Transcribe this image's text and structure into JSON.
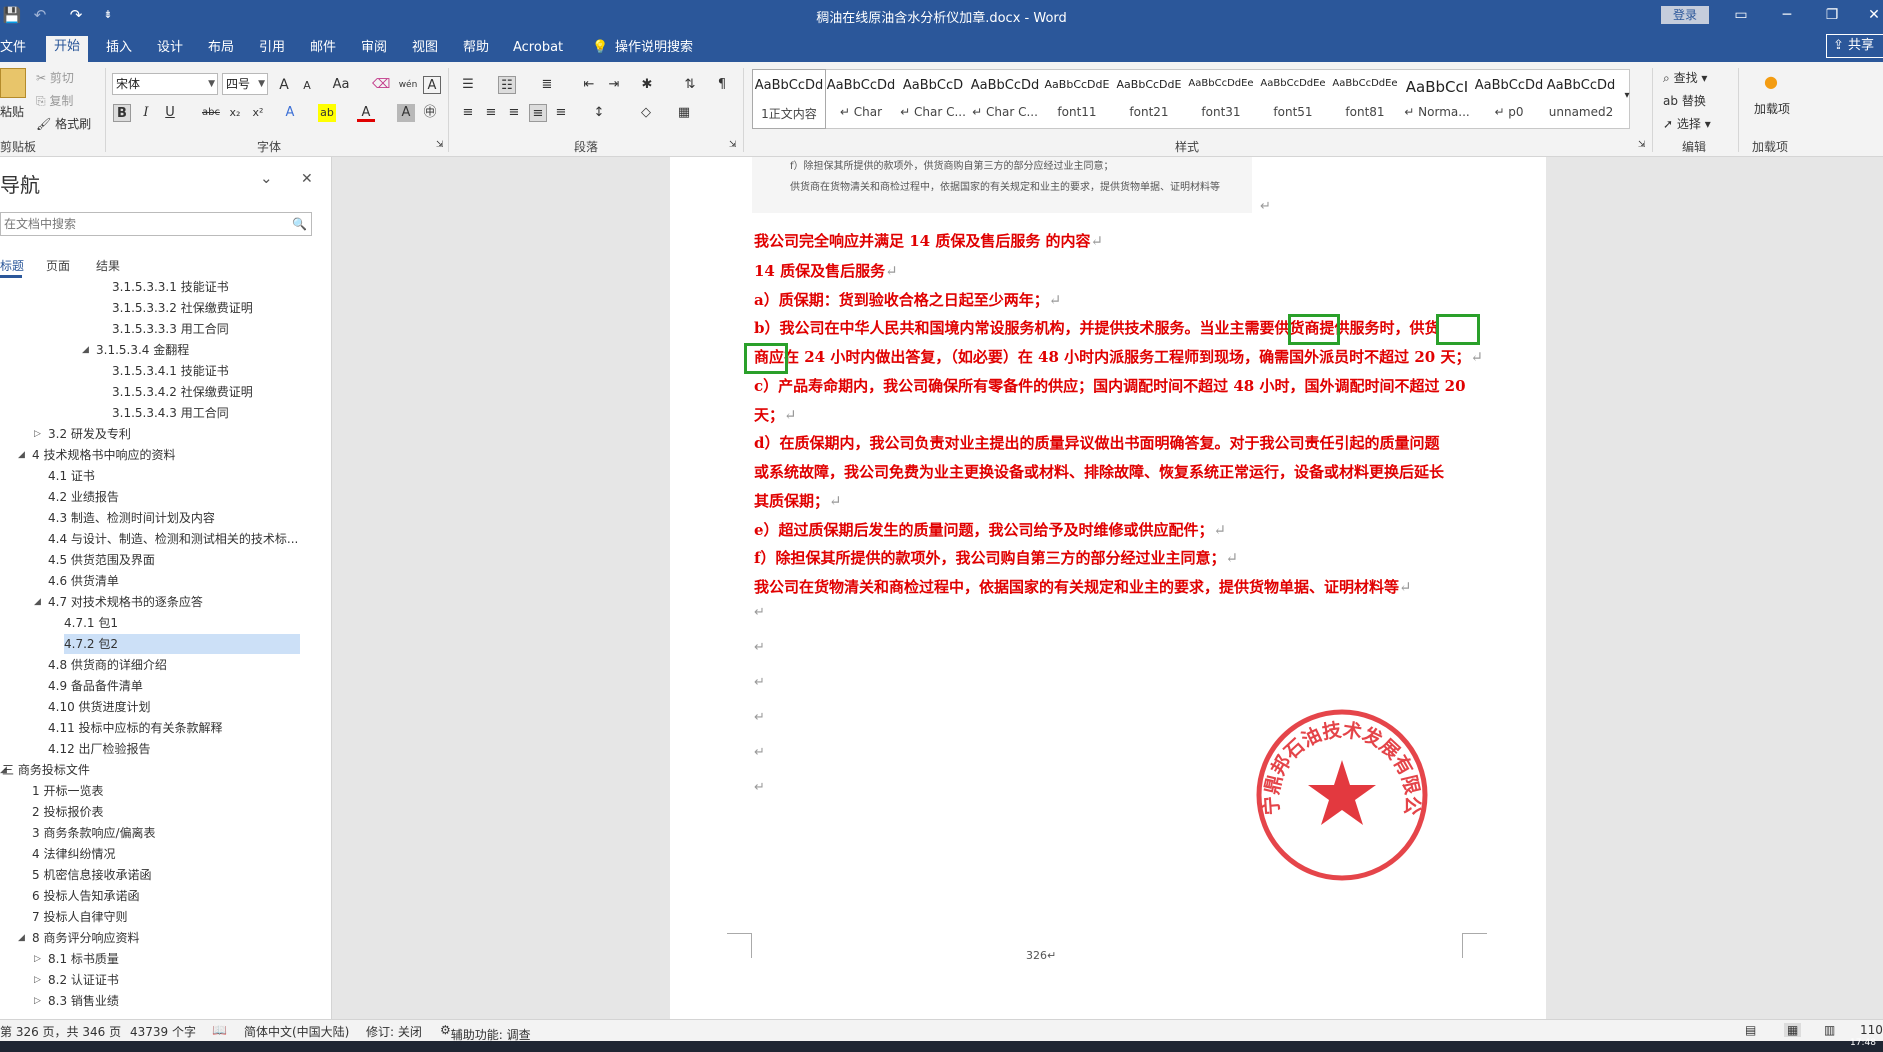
{
  "titlebar": {
    "title": "稠油在线原油含水分析仪加章.docx  -  Word",
    "login": "登录",
    "save_icon": "💾",
    "undo_icon": "↶",
    "redo_icon": "↷",
    "customize_icon": "⇟",
    "ribbon_display_icon": "▭",
    "minimize_icon": "─",
    "restore_icon": "❐",
    "close_icon": "✕"
  },
  "tabs": [
    "文件",
    "开始",
    "插入",
    "设计",
    "布局",
    "引用",
    "邮件",
    "审阅",
    "视图",
    "帮助",
    "Acrobat",
    "操作说明搜索"
  ],
  "tell_me_icon": "💡",
  "share": "共享",
  "share_icon": "⇪",
  "clipboard": {
    "paste": "粘贴",
    "cut": "剪切",
    "copy": "复制",
    "format_painter": "格式刷",
    "group": "剪贴板"
  },
  "font": {
    "name": "宋体",
    "size": "四号",
    "grow": "A",
    "shrink": "A",
    "change_case": "Aa",
    "clear_icon": "⌫",
    "phonetic": "wén",
    "border_char": "A",
    "bold": "B",
    "italic": "I",
    "underline": "U",
    "strike": "abc",
    "subscript": "x₂",
    "superscript": "x²",
    "effects": "A",
    "highlight": "ab",
    "font_color": "A",
    "shading": "A",
    "enclose": "㊥",
    "group": "字体"
  },
  "paragraph": {
    "group": "段落",
    "icons": [
      "☰",
      "☷",
      "≣",
      "⇤",
      "⇥",
      "✱",
      "⇅",
      "¶",
      "≡",
      "≡",
      "≡",
      "≡",
      "≡",
      "↕",
      "◇",
      "▦"
    ]
  },
  "styles": {
    "group": "样式",
    "items": [
      {
        "preview": "AaBbCcDd",
        "name": "1正文内容"
      },
      {
        "preview": "AaBbCcDd",
        "name": "↵ Char"
      },
      {
        "preview": "AaBbCcD",
        "name": "↵ Char C..."
      },
      {
        "preview": "AaBbCcDd",
        "name": "↵ Char C..."
      },
      {
        "preview": "AaBbCcDdE",
        "name": "font11"
      },
      {
        "preview": "AaBbCcDdE",
        "name": "font21"
      },
      {
        "preview": "AaBbCcDdEe",
        "name": "font31"
      },
      {
        "preview": "AaBbCcDdEe",
        "name": "font51"
      },
      {
        "preview": "AaBbCcDdEe",
        "name": "font81"
      },
      {
        "preview": "AaBbCcI",
        "name": "↵ Norma..."
      },
      {
        "preview": "AaBbCcDd",
        "name": "↵ p0"
      },
      {
        "preview": "AaBbCcDd",
        "name": "unnamed2"
      }
    ]
  },
  "editing": {
    "find": "查找",
    "replace": "替换",
    "select": "选择",
    "group": "编辑"
  },
  "addins": {
    "label": "加载项",
    "group": "加载项"
  },
  "nav": {
    "title": "导航",
    "search_placeholder": "在文档中搜索",
    "tabs": [
      "标题",
      "页面",
      "结果"
    ],
    "collapse_icon": "⌄",
    "close_icon": "✕",
    "search_icon": "🔍",
    "items": [
      {
        "text": "3.1.5.3.3.1 技能证书",
        "level": 5
      },
      {
        "text": "3.1.5.3.3.2 社保缴费证明",
        "level": 5
      },
      {
        "text": "3.1.5.3.3.3 用工合同",
        "level": 5
      },
      {
        "text": "3.1.5.3.4 金翻程",
        "level": 4,
        "toggle": "◢"
      },
      {
        "text": "3.1.5.3.4.1 技能证书",
        "level": 5
      },
      {
        "text": "3.1.5.3.4.2 社保缴费证明",
        "level": 5
      },
      {
        "text": "3.1.5.3.4.3 用工合同",
        "level": 5
      },
      {
        "text": "3.2 研发及专利",
        "level": 2,
        "toggle": "▷"
      },
      {
        "text": "4 技术规格书中响应的资料",
        "level": 1,
        "toggle": "◢"
      },
      {
        "text": "4.1 证书",
        "level": 2
      },
      {
        "text": "4.2 业绩报告",
        "level": 2
      },
      {
        "text": "4.3 制造、检测时间计划及内容",
        "level": 2
      },
      {
        "text": "4.4 与设计、制造、检测和测试相关的技术标...",
        "level": 2
      },
      {
        "text": "4.5 供货范围及界面",
        "level": 2
      },
      {
        "text": "4.6 供货清单",
        "level": 2
      },
      {
        "text": "4.7 对技术规格书的逐条应答",
        "level": 2,
        "toggle": "◢"
      },
      {
        "text": "4.7.1 包1",
        "level": 3
      },
      {
        "text": "4.7.2 包2",
        "level": 3,
        "selected": true
      },
      {
        "text": "4.8 供货商的详细介绍",
        "level": 2
      },
      {
        "text": "4.9 备品备件清单",
        "level": 2
      },
      {
        "text": "4.10 供货进度计划",
        "level": 2
      },
      {
        "text": "4.11 投标中应标的有关条款解释",
        "level": 2
      },
      {
        "text": "4.12 出厂检验报告",
        "level": 2
      },
      {
        "text": "三 商务投标文件",
        "level": 0,
        "toggle": "◢"
      },
      {
        "text": "1 开标一览表",
        "level": 1
      },
      {
        "text": "2 投标报价表",
        "level": 1
      },
      {
        "text": "3 商务条款响应/偏离表",
        "level": 1
      },
      {
        "text": "4 法律纠纷情况",
        "level": 1
      },
      {
        "text": "5 机密信息接收承诺函",
        "level": 1
      },
      {
        "text": "6 投标人告知承诺函",
        "level": 1
      },
      {
        "text": "7 投标人自律守则",
        "level": 1
      },
      {
        "text": "8 商务评分响应资料",
        "level": 1,
        "toggle": "◢"
      },
      {
        "text": "8.1 标书质量",
        "level": 2,
        "toggle": "▷"
      },
      {
        "text": "8.2 认证证书",
        "level": 2,
        "toggle": "▷"
      },
      {
        "text": "8.3 销售业绩",
        "level": 2,
        "toggle": "▷"
      }
    ]
  },
  "document": {
    "header_lines": [
      "f）除担保其所提供的款项外，供货商购自第三方的部分应经过业主同意；",
      "供货商在货物清关和商检过程中，依据国家的有关规定和业主的要求，提供货物单据、证明材料等"
    ],
    "lines": [
      "我公司完全响应并满足 14 质保及售后服务 的内容",
      "14 质保及售后服务",
      "a）质保期：货到验收合格之日起至少两年；",
      "b）我公司在中华人民共和国境内常设服务机构，并提供技术服务。当业主需要供货商提供服务时，供货",
      "商应在 24 小时内做出答复，（如必要）在 48 小时内派服务工程师到现场，确需国外派员时不超过 20 天；",
      "c）产品寿命期内，我公司确保所有零备件的供应；国内调配时间不超过 48 小时，国外调配时间不超过 20",
      "天；",
      "d）在质保期内，我公司负责对业主提出的质量异议做出书面明确答复。对于我公司责任引起的质量问题",
      "或系统故障，我公司免费为业主更换设备或材料、排除故障、恢复系统正常运行，设备或材料更换后延长",
      "其质保期；",
      "e）超过质保期后发生的质量问题，我公司给予及时维修或供应配件；",
      "f）除担保其所提供的款项外，我公司购自第三方的部分经过业主同意；",
      "我公司在货物清关和商检过程中，依据国家的有关规定和业主的要求，提供货物单据、证明材料等"
    ],
    "para_mark": "↵",
    "page_number": "326",
    "seal_text": "辽宁鼎邦石油技术发展有限公司",
    "seal_color": "#e0242a"
  },
  "statusbar": {
    "page": "第 326 页，共 346 页",
    "words": "43739 个字",
    "proof_icon": "📖",
    "language": "简体中文(中国大陆)",
    "track": "修订: 关闭",
    "accessibility": "辅助功能: 调查",
    "zoom": "110",
    "read_icon": "▤",
    "print_icon": "▦",
    "web_icon": "▥"
  },
  "taskbar": {
    "time": "17:48"
  },
  "colors": {
    "brand": "#2b579a",
    "doc_text": "#e00000",
    "highlight_box": "#2aa02a"
  }
}
